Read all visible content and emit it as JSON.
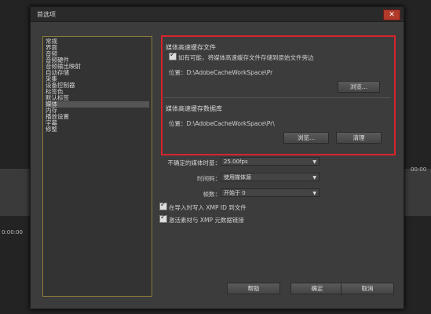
{
  "background": {
    "time_left": "0:00:00",
    "time_right": "00:00"
  },
  "dialog": {
    "title": "首选项",
    "close_icon": "close-icon"
  },
  "sidebar": {
    "items": [
      {
        "label": "常规"
      },
      {
        "label": "界面"
      },
      {
        "label": "音频"
      },
      {
        "label": "音频硬件"
      },
      {
        "label": "音频输出映射"
      },
      {
        "label": "自动存储"
      },
      {
        "label": "采集"
      },
      {
        "label": "设备控制器"
      },
      {
        "label": "标签色"
      },
      {
        "label": "默认标签"
      },
      {
        "label": "媒体",
        "selected": true
      },
      {
        "label": "内存"
      },
      {
        "label": "播放设置"
      },
      {
        "label": "字幕"
      },
      {
        "label": "修整"
      }
    ]
  },
  "media_cache": {
    "group_title": "媒体高速缓存文件",
    "save_next_checkbox": "如有可能，将媒体高速缓存文件存储到原始文件旁边",
    "location_label": "位置：D:\\AdobeCacheWorkSpace\\Pr",
    "browse_button": "浏览..."
  },
  "media_db": {
    "group_title": "媒体高速缓存数据库",
    "location_label": "位置：D:\\AdobeCacheWorkSpace\\Pr\\",
    "browse_button": "浏览...",
    "clean_button": "清理"
  },
  "settings": {
    "timebase_label": "不确定的媒体时基：",
    "timebase_value": "25.00fps",
    "timecode_label": "时间码：",
    "timecode_value": "使用媒体源",
    "frame_label": "帧数：",
    "frame_value": "开始于 0",
    "xmp_write_checkbox": "在导入时写入 XMP ID 到文件",
    "xmp_link_checkbox": "激活素材与 XMP 元数据链接"
  },
  "footer": {
    "help_button": "帮助",
    "ok_button": "确定",
    "cancel_button": "取消"
  }
}
